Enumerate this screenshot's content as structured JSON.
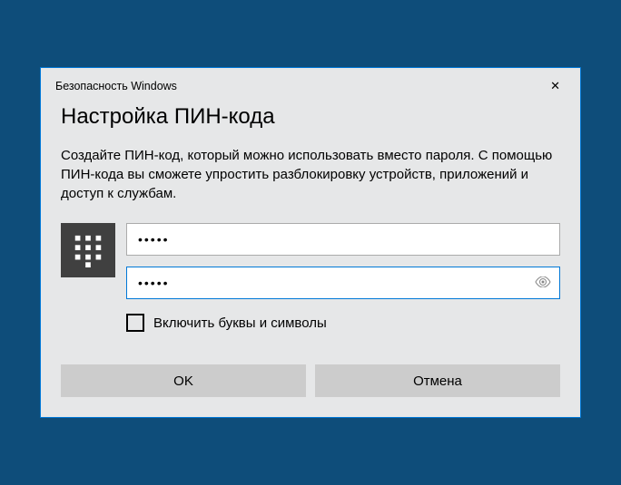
{
  "titlebar": {
    "title": "Безопасность Windows"
  },
  "dialog": {
    "heading": "Настройка ПИН-кода",
    "description": "Создайте ПИН-код, который можно использовать вместо пароля. С помощью ПИН-кода вы сможете упростить разблокировку устройств, приложений и доступ к службам."
  },
  "form": {
    "pin_value": "•••••",
    "pin_confirm_value": "•••••",
    "checkbox_label": "Включить буквы и символы",
    "checkbox_checked": false
  },
  "buttons": {
    "ok": "OK",
    "cancel": "Отмена"
  }
}
